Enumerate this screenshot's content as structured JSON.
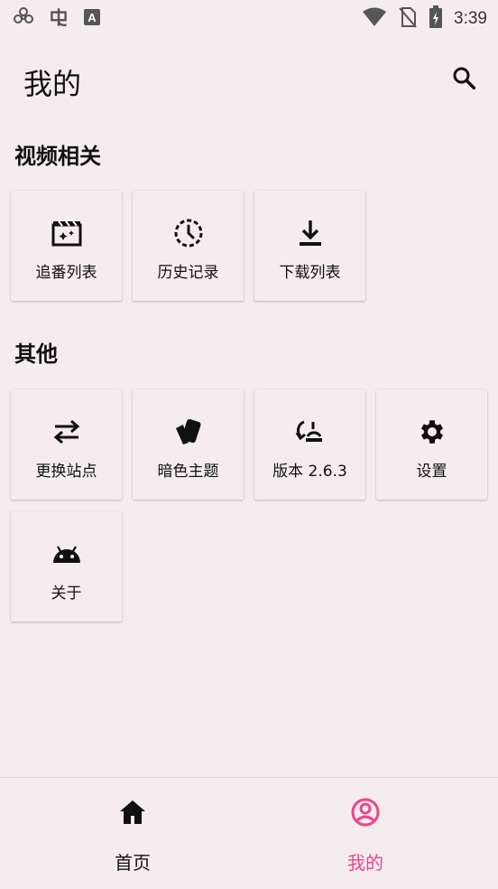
{
  "status_bar": {
    "time": "3:39",
    "left_icons": [
      "flower-icon",
      "bug-icon",
      "font-a-icon"
    ],
    "right_icons": [
      "wifi-icon",
      "no-sim-icon",
      "battery-charging-icon"
    ]
  },
  "header": {
    "title": "我的",
    "search_icon": "search-icon"
  },
  "sections": {
    "video": {
      "title": "视频相关",
      "items": [
        {
          "label": "追番列表",
          "icon": "movie-sparkle-icon"
        },
        {
          "label": "历史记录",
          "icon": "history-clock-icon"
        },
        {
          "label": "下载列表",
          "icon": "download-icon"
        }
      ]
    },
    "other": {
      "title": "其他",
      "items": [
        {
          "label": "更换站点",
          "icon": "swap-arrows-icon"
        },
        {
          "label": "暗色主题",
          "icon": "theme-cards-icon"
        },
        {
          "label": "版本 2.6.3",
          "icon": "update-icon"
        },
        {
          "label": "设置",
          "icon": "gear-icon"
        },
        {
          "label": "关于",
          "icon": "android-icon"
        }
      ]
    }
  },
  "bottom_nav": {
    "items": [
      {
        "label": "首页",
        "icon": "home-icon",
        "active": false
      },
      {
        "label": "我的",
        "icon": "account-circle-icon",
        "active": true
      }
    ]
  },
  "colors": {
    "background": "#f4ecee",
    "accent": "#f0458a",
    "text": "#111111"
  }
}
